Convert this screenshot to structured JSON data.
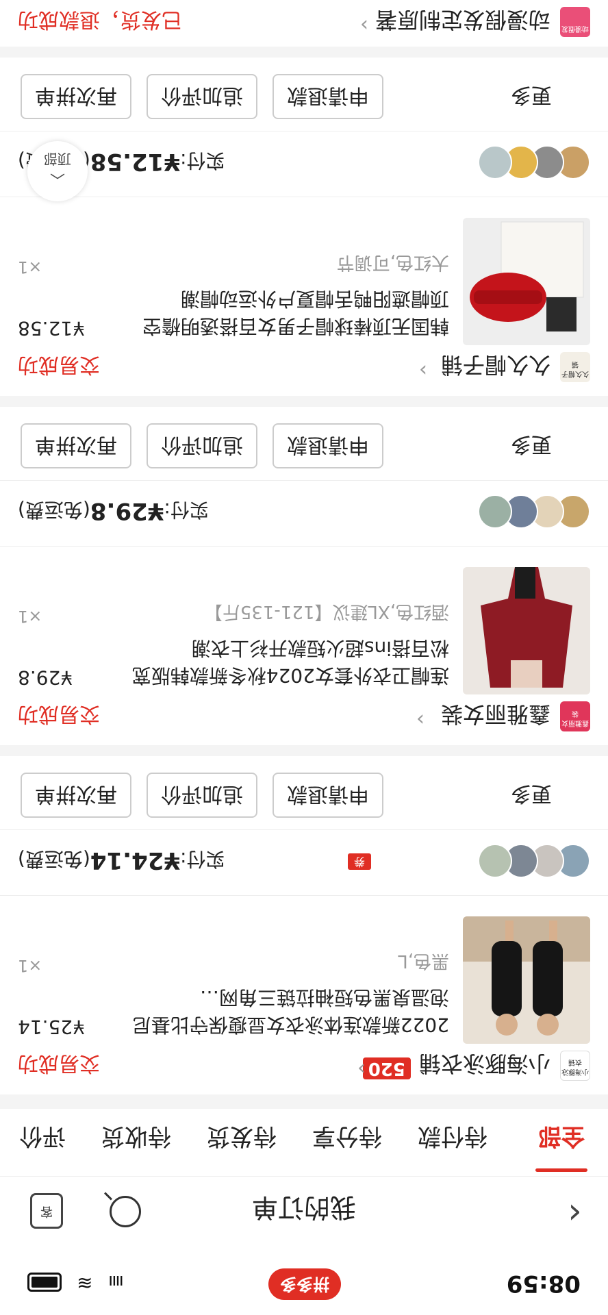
{
  "status_bar": {
    "time": "08:59",
    "app_pill": "拼多多",
    "signal_glyph": "ıııı",
    "wifi_glyph": "≋"
  },
  "nav": {
    "back_glyph": "‹",
    "title": "我的订单",
    "support_glyph": "客"
  },
  "tabs": [
    "全部",
    "待付款",
    "待分享",
    "待发货",
    "待收货",
    "评价"
  ],
  "active_tab": 0,
  "orders": [
    {
      "shop_name": "小海豚泳衣铺",
      "shop_logo_text": "小海豚泳衣铺",
      "badge": "520",
      "status": "交易成功",
      "title": "2022新款连体泳衣女显瘦保守比基尼泡温泉黑色短袖拉链三角网…",
      "price": "¥25.14",
      "qty": "×1",
      "spec": "黑色,L",
      "paid_label": "实付:",
      "paid_amount": "¥24.14",
      "shipping": "(免运费)",
      "coupon": "券",
      "more": "更多",
      "buttons": [
        "申请退款",
        "追加评价",
        "再次拼单"
      ]
    },
    {
      "shop_name": "鑫雅丽女装",
      "shop_logo_text": "鑫雅丽女装",
      "status": "交易成功",
      "title": "连帽卫衣外套女2024秋冬新款韩版宽松百搭ins超火短款开衫上衣潮",
      "price": "¥29.8",
      "qty": "×1",
      "spec": "酒红色,XL建议【121-135斤】",
      "paid_label": "实付:",
      "paid_amount": "¥29.8",
      "shipping": "(免运费)",
      "more": "更多",
      "buttons": [
        "申请退款",
        "追加评价",
        "再次拼单"
      ]
    },
    {
      "shop_name": "久久帽子铺",
      "shop_logo_text": "久久帽子铺",
      "status": "交易成功",
      "title": "韩国无顶棒球帽子男女百搭透明檐空顶帽遮阳鸭舌帽夏户外运动帽潮",
      "price": "¥12.58",
      "qty": "×1",
      "spec": "大红色,可调节",
      "paid_label": "实付:",
      "paid_amount": "¥12.58",
      "shipping": "(免运费)",
      "more": "更多",
      "buttons": [
        "申请退款",
        "追加评价",
        "再次拼单"
      ]
    },
    {
      "shop_name": "动漫假发定制原著",
      "shop_logo_text": "动漫假发",
      "status": "已发货，退款成功"
    }
  ],
  "float_top": {
    "label": "顶部",
    "arrow": "︿"
  },
  "colors": {
    "brand": "#e02e24",
    "background": "#f4f4f4"
  }
}
